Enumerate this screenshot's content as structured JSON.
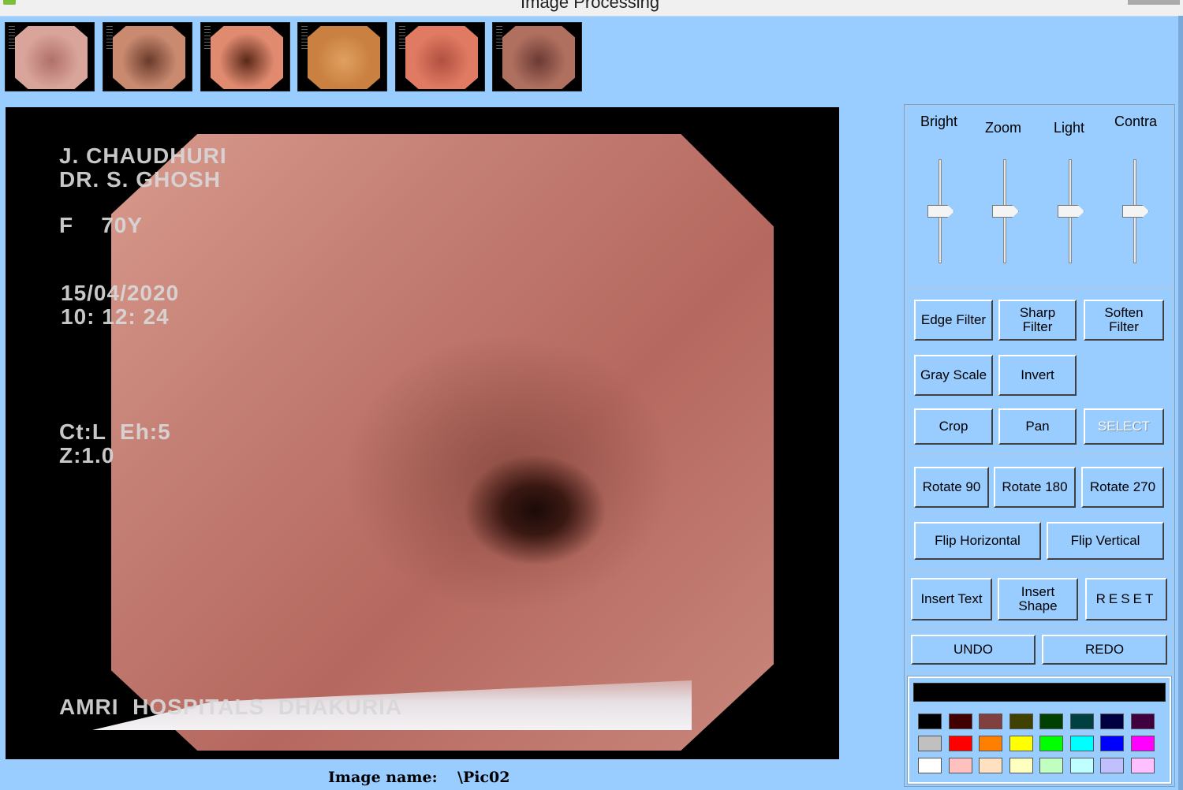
{
  "window": {
    "title": "Image Processing"
  },
  "thumbnails": [
    {
      "name": "thumbnail-1",
      "colors": [
        "#d9a49a",
        "#b0706a"
      ]
    },
    {
      "name": "thumbnail-2",
      "colors": [
        "#c98a70",
        "#6a3a2a"
      ]
    },
    {
      "name": "thumbnail-3",
      "colors": [
        "#e08a70",
        "#5a2818"
      ]
    },
    {
      "name": "thumbnail-4",
      "colors": [
        "#c98040",
        "#e0a060"
      ]
    },
    {
      "name": "thumbnail-5",
      "colors": [
        "#e07a62",
        "#b05040"
      ]
    },
    {
      "name": "thumbnail-6",
      "colors": [
        "#b07060",
        "#6a3a34"
      ]
    }
  ],
  "overlay": {
    "patient": "J. CHAUDHURI",
    "doctor": "DR. S. GHOSH",
    "sex_age": "F    70Y",
    "date": "15/04/2020",
    "time": "10: 12: 24",
    "ct": "Ct:L  Eh:5",
    "zoom": "Z:1.0",
    "hospital": "AMRI  HOSPITALS  DHAKURIA"
  },
  "image_name": {
    "label": "Image name:",
    "value": "\\Pic02"
  },
  "sliders": [
    {
      "label": "Bright",
      "value": 0.5
    },
    {
      "label": "Zoom",
      "value": 0.5
    },
    {
      "label": "Light",
      "value": 0.5
    },
    {
      "label": "Contra",
      "value": 0.5
    }
  ],
  "buttons": {
    "edge_filter": "Edge Filter",
    "sharp_filter": "Sharp\nFilter",
    "soften_filter": "Soften\nFilter",
    "gray_scale": "Gray Scale",
    "invert": "Invert",
    "crop": "Crop",
    "pan": "Pan",
    "select": "SELECT",
    "rotate_90": "Rotate 90",
    "rotate_180": "Rotate 180",
    "rotate_270": "Rotate 270",
    "flip_horizontal": "Flip Horizontal",
    "flip_vertical": "Flip Vertical",
    "insert_text": "Insert Text",
    "insert_shape": "Insert\nShape",
    "reset": "RESET",
    "undo": "UNDO",
    "redo": "REDO"
  },
  "palette": {
    "current": "#000000",
    "rows": [
      [
        "#000000",
        "#400000",
        "#804040",
        "#404000",
        "#004000",
        "#004040",
        "#000040",
        "#400040"
      ],
      [
        "#c0c0c0",
        "#ff0000",
        "#ff8000",
        "#ffff00",
        "#00ff00",
        "#00ffff",
        "#0000ff",
        "#ff00ff"
      ],
      [
        "#ffffff",
        "#ffc0c0",
        "#ffe0c0",
        "#ffffc0",
        "#c0ffc0",
        "#c0ffff",
        "#c0c0ff",
        "#ffc0ff"
      ]
    ]
  }
}
